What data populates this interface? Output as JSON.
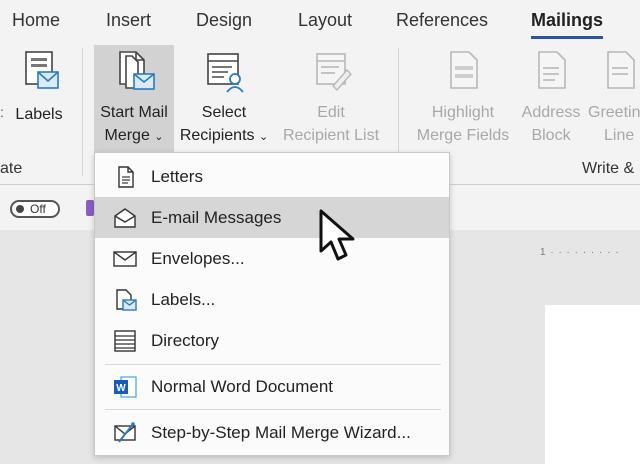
{
  "tabs": [
    {
      "label": "Home"
    },
    {
      "label": "Insert"
    },
    {
      "label": "Design"
    },
    {
      "label": "Layout"
    },
    {
      "label": "References"
    },
    {
      "label": "Mailings"
    }
  ],
  "ribbon": {
    "labels": {
      "label": "Labels"
    },
    "start_mail_merge": {
      "line1": "Start Mail",
      "line2": "Merge"
    },
    "select_recipients": {
      "line1": "Select",
      "line2": "Recipients"
    },
    "edit_recipient_list": {
      "line1": "Edit",
      "line2": "Recipient List"
    },
    "highlight_merge_fields": {
      "line1": "Highlight",
      "line2": "Merge Fields"
    },
    "address_block": {
      "line1": "Address",
      "line2": "Block"
    },
    "greeting_line": {
      "line1": "Greeting",
      "line2": "Line"
    },
    "group_left_label": "ate",
    "group_write_label": "Write &"
  },
  "toggle": {
    "label": "Off"
  },
  "menu": {
    "items": [
      {
        "label": "Letters"
      },
      {
        "label": "E-mail Messages"
      },
      {
        "label": "Envelopes..."
      },
      {
        "label": "Labels..."
      },
      {
        "label": "Directory"
      },
      {
        "label": "Normal Word Document"
      },
      {
        "label": "Step-by-Step Mail Merge Wizard..."
      }
    ]
  },
  "colors": {
    "accent": "#2b579a",
    "hover": "#d6d6d6",
    "disabled": "#a8a8a8"
  }
}
